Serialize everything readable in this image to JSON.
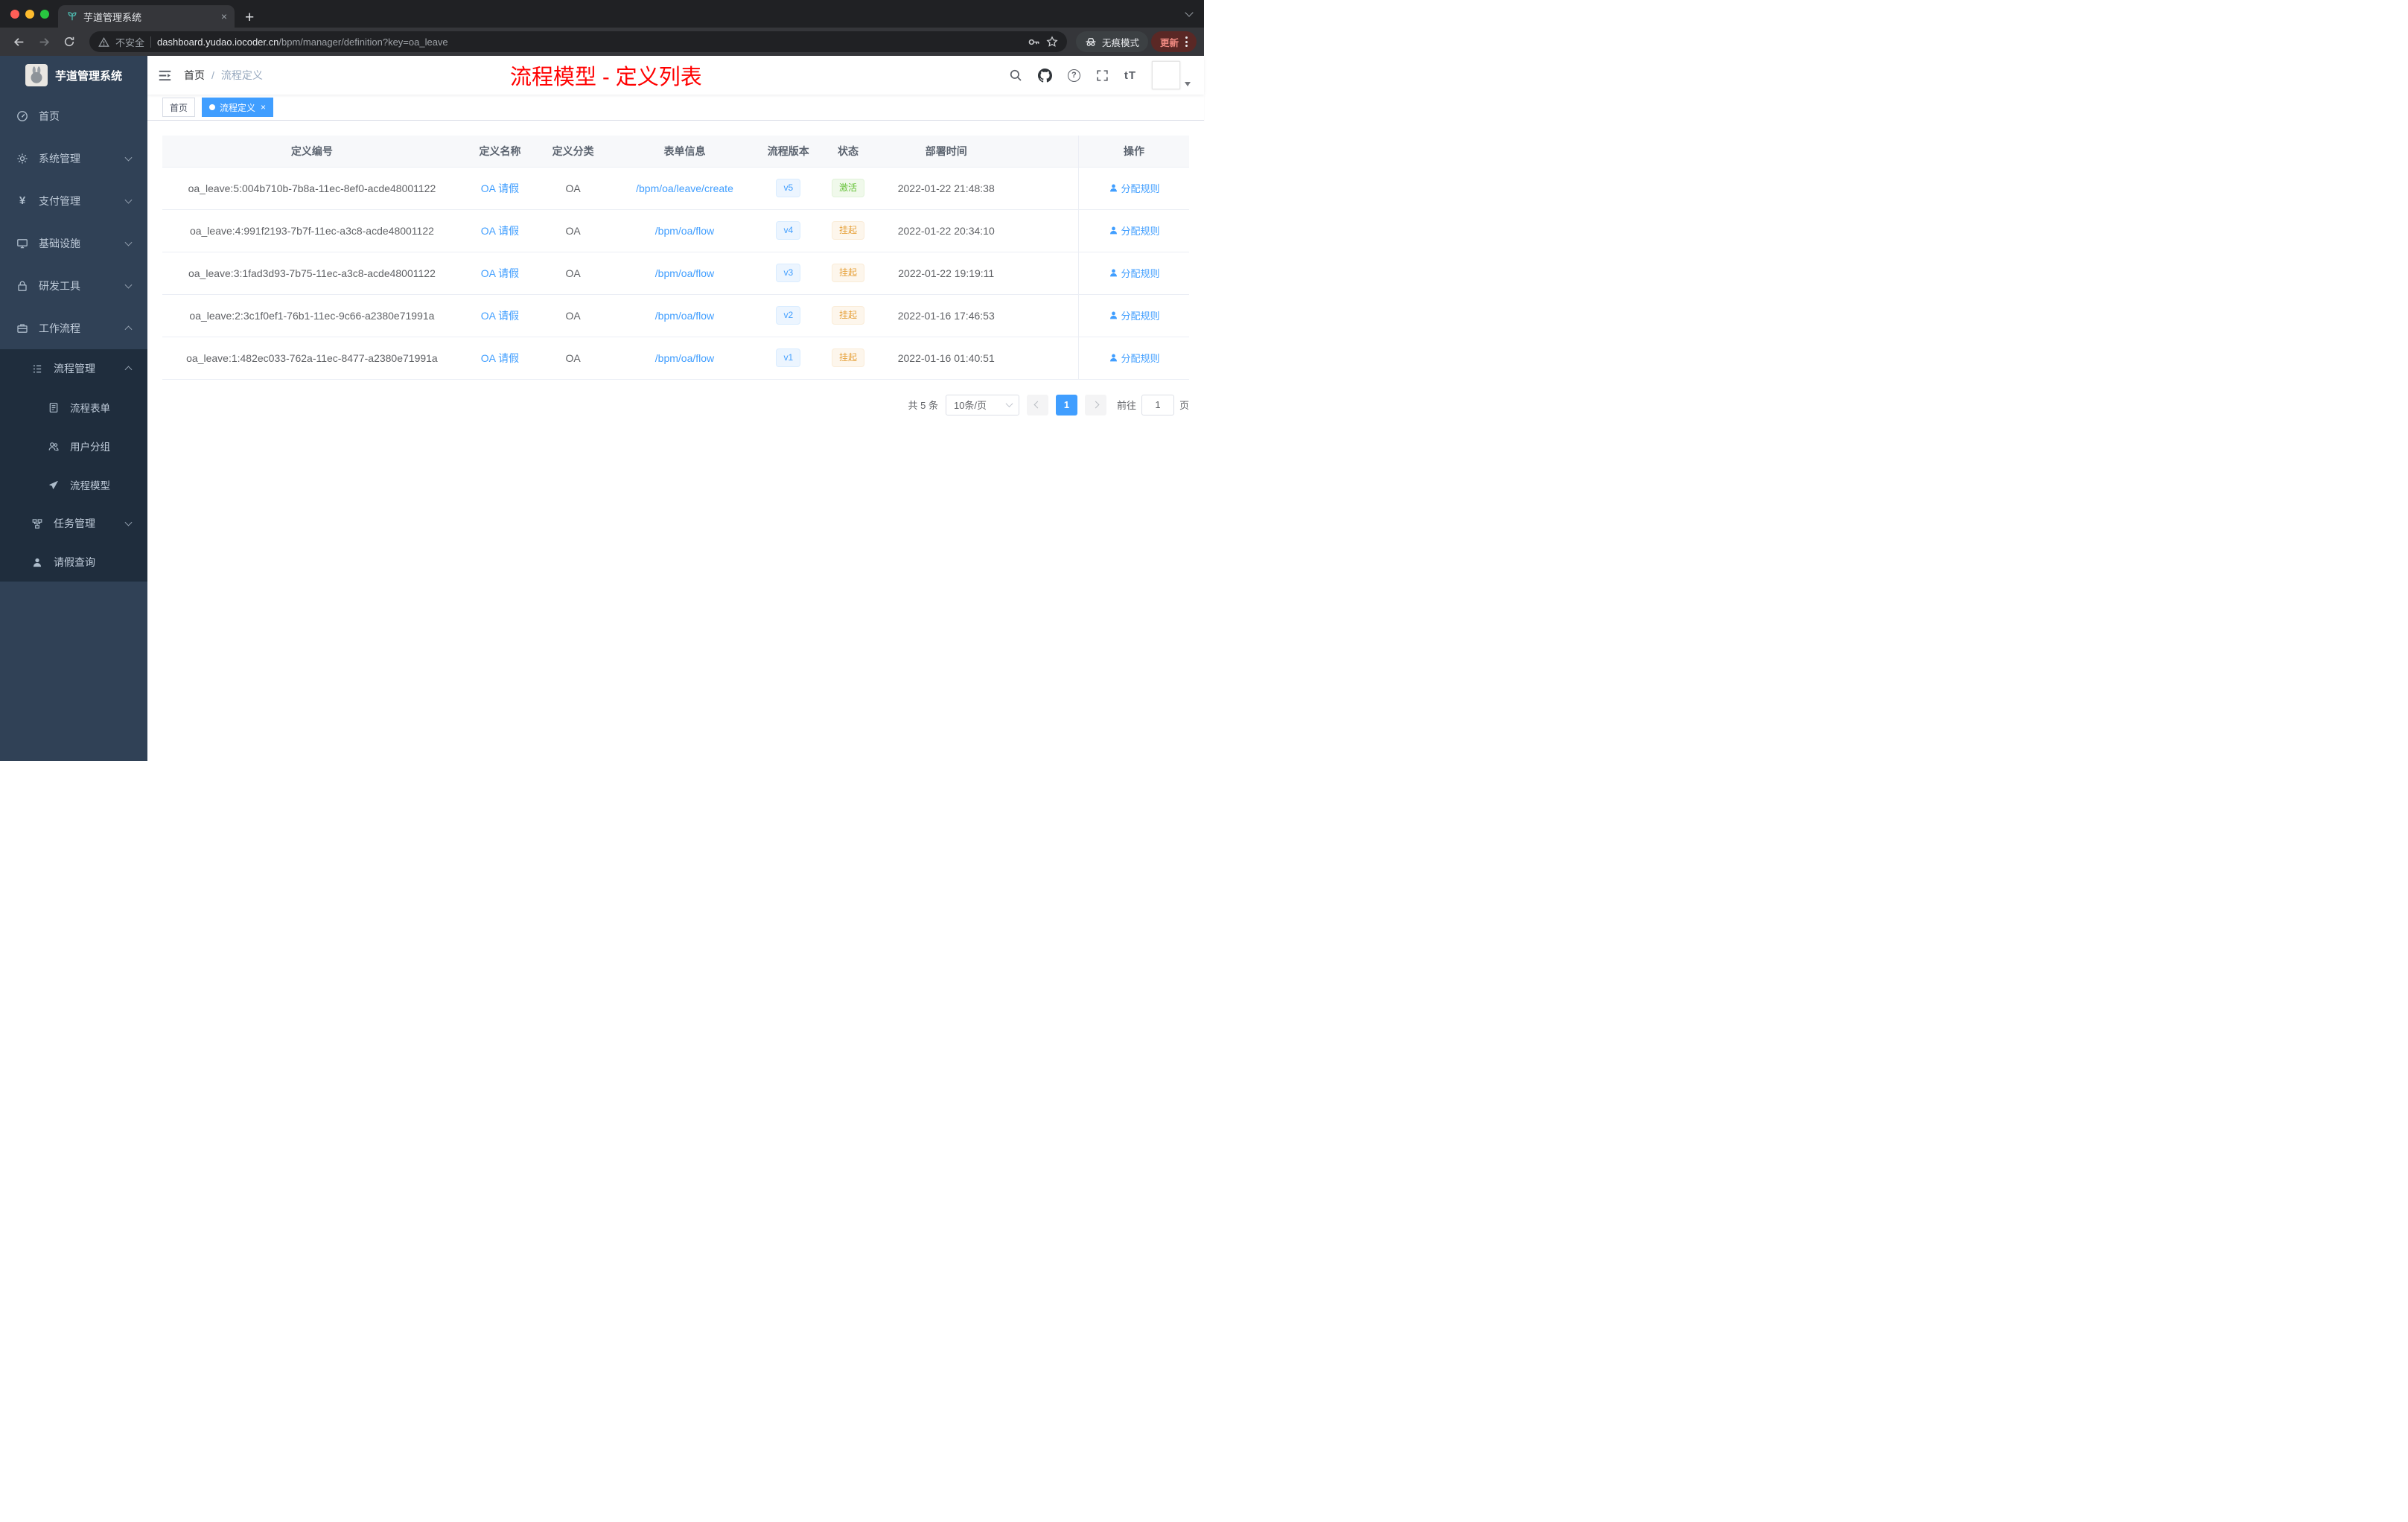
{
  "browser": {
    "tab_title": "芋道管理系统",
    "security_label": "不安全",
    "url_domain": "dashboard.yudao.iocoder.cn",
    "url_path": "/bpm/manager/definition?key=oa_leave",
    "incognito_label": "无痕模式",
    "update_label": "更新"
  },
  "glyphs": {
    "plus": "+",
    "close": "×",
    "yen": "¥",
    "font_size": "tT",
    "question": "?"
  },
  "sidebar": {
    "logo_title": "芋道管理系统",
    "items": [
      {
        "label": "首页"
      },
      {
        "label": "系统管理"
      },
      {
        "label": "支付管理"
      },
      {
        "label": "基础设施"
      },
      {
        "label": "研发工具"
      },
      {
        "label": "工作流程"
      },
      {
        "label": "流程管理"
      },
      {
        "label": "流程表单"
      },
      {
        "label": "用户分组"
      },
      {
        "label": "流程模型"
      },
      {
        "label": "任务管理"
      },
      {
        "label": "请假查询"
      }
    ]
  },
  "header": {
    "breadcrumb": {
      "home": "首页",
      "separator": "/",
      "current": "流程定义"
    },
    "page_title": "流程模型 - 定义列表"
  },
  "tags_view": {
    "tags": [
      {
        "label": "首页",
        "active": false
      },
      {
        "label": "流程定义",
        "active": true
      }
    ]
  },
  "table": {
    "columns": {
      "id": "定义编号",
      "name": "定义名称",
      "category": "定义分类",
      "form": "表单信息",
      "version": "流程版本",
      "status": "状态",
      "deploy_time": "部署时间",
      "action": "操作"
    },
    "rows": [
      {
        "id": "oa_leave:5:004b710b-7b8a-11ec-8ef0-acde48001122",
        "name": "OA 请假",
        "category": "OA",
        "form": "/bpm/oa/leave/create",
        "version": "v5",
        "status": "激活",
        "status_type": "success",
        "deploy_time": "2022-01-22 21:48:38",
        "action": "分配规则"
      },
      {
        "id": "oa_leave:4:991f2193-7b7f-11ec-a3c8-acde48001122",
        "name": "OA 请假",
        "category": "OA",
        "form": "/bpm/oa/flow",
        "version": "v4",
        "status": "挂起",
        "status_type": "warning",
        "deploy_time": "2022-01-22 20:34:10",
        "action": "分配规则"
      },
      {
        "id": "oa_leave:3:1fad3d93-7b75-11ec-a3c8-acde48001122",
        "name": "OA 请假",
        "category": "OA",
        "form": "/bpm/oa/flow",
        "version": "v3",
        "status": "挂起",
        "status_type": "warning",
        "deploy_time": "2022-01-22 19:19:11",
        "action": "分配规则"
      },
      {
        "id": "oa_leave:2:3c1f0ef1-76b1-11ec-9c66-a2380e71991a",
        "name": "OA 请假",
        "category": "OA",
        "form": "/bpm/oa/flow",
        "version": "v2",
        "status": "挂起",
        "status_type": "warning",
        "deploy_time": "2022-01-16 17:46:53",
        "action": "分配规则"
      },
      {
        "id": "oa_leave:1:482ec033-762a-11ec-8477-a2380e71991a",
        "name": "OA 请假",
        "category": "OA",
        "form": "/bpm/oa/flow",
        "version": "v1",
        "status": "挂起",
        "status_type": "warning",
        "deploy_time": "2022-01-16 01:40:51",
        "action": "分配规则"
      }
    ]
  },
  "pagination": {
    "total": "共 5 条",
    "page_size": "10条/页",
    "page": "1",
    "goto_label": "前往",
    "goto_value": "1",
    "goto_unit": "页"
  },
  "colors": {
    "accent": "#409EFF",
    "success": "#67C23A",
    "warning": "#E6A23C",
    "title_red": "#FF0000",
    "sidebar_bg": "#304156",
    "submenu_bg": "#1F2D3D"
  }
}
